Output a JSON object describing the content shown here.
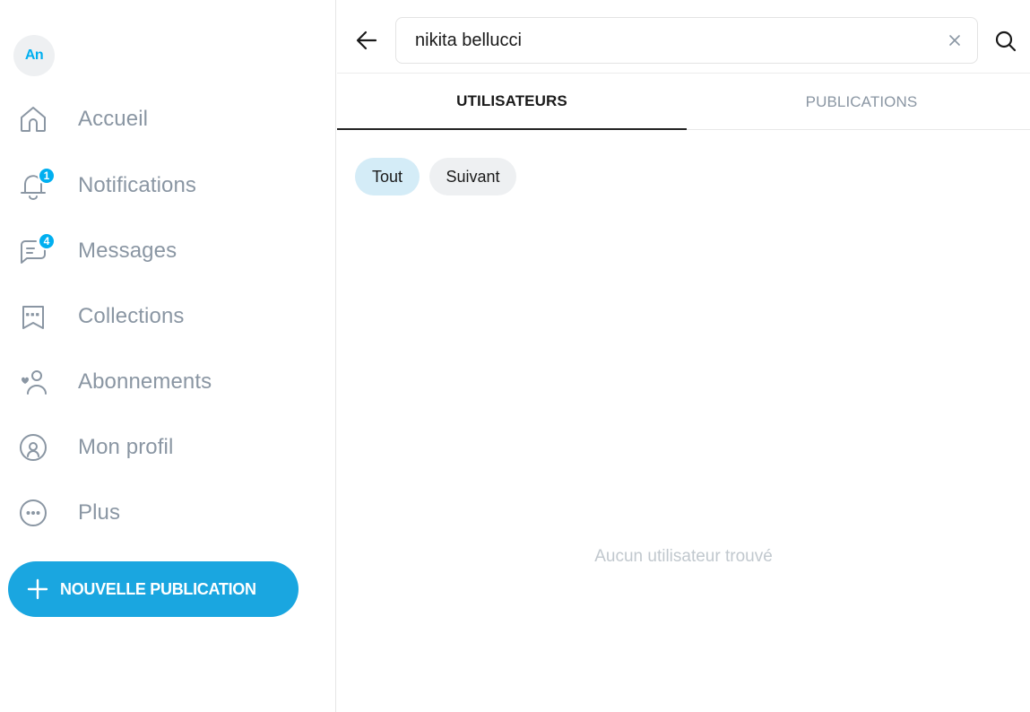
{
  "user": {
    "avatar_initials": "An"
  },
  "sidebar": {
    "items": [
      {
        "label": "Accueil",
        "icon": "home-icon"
      },
      {
        "label": "Notifications",
        "icon": "bell-icon",
        "badge": "1"
      },
      {
        "label": "Messages",
        "icon": "chat-icon",
        "badge": "4"
      },
      {
        "label": "Collections",
        "icon": "bookmark-stars-icon"
      },
      {
        "label": "Abonnements",
        "icon": "subscriptions-icon"
      },
      {
        "label": "Mon profil",
        "icon": "profile-icon"
      },
      {
        "label": "Plus",
        "icon": "more-icon"
      }
    ],
    "new_post_label": "NOUVELLE PUBLICATION"
  },
  "search": {
    "query": "nikita bellucci",
    "clear_icon": "close-icon",
    "search_icon": "search-icon"
  },
  "tabs": [
    {
      "label": "UTILISATEURS",
      "active": true
    },
    {
      "label": "PUBLICATIONS",
      "active": false
    }
  ],
  "filters": [
    {
      "label": "Tout",
      "selected": true
    },
    {
      "label": "Suivant",
      "selected": false
    }
  ],
  "empty_state": "Aucun utilisateur trouvé",
  "colors": {
    "accent": "#00aff0",
    "button": "#1aa6e0",
    "chip_selected": "#d4ecf7",
    "chip": "#eef0f2",
    "muted_text": "#8a96a3"
  }
}
